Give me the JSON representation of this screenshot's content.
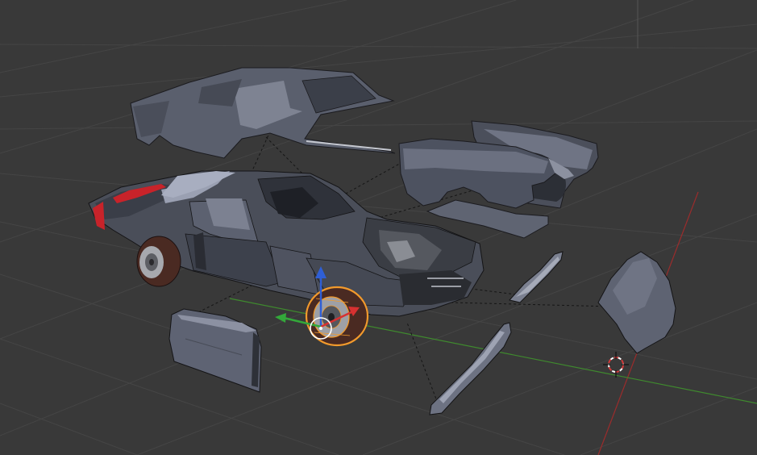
{
  "viewport": {
    "background": "#393939",
    "grid_color": "#454545",
    "x_axis_color": "#9b2c2c",
    "y_axis_color": "#3f8a2e",
    "body_color": "#5c6170",
    "body_dark": "#3d414c",
    "tire_color": "#4a2a22",
    "selection_color": "#f29a2c",
    "accent_red": "#c8232a"
  },
  "scene": {
    "parts": [
      "roof-shell",
      "quarter-panel",
      "front-fender",
      "door-panel",
      "rocker-panel",
      "hood-panel",
      "bumper-strip",
      "car-body",
      "rear-wheel",
      "front-wheel-selected"
    ]
  },
  "gizmo": {
    "icons": [
      "z-axis-arrow-icon",
      "x-axis-arrow-icon",
      "y-axis-arrow-icon",
      "pivot-ring-icon"
    ]
  },
  "cursor": {
    "icon": "3d-cursor-icon"
  }
}
